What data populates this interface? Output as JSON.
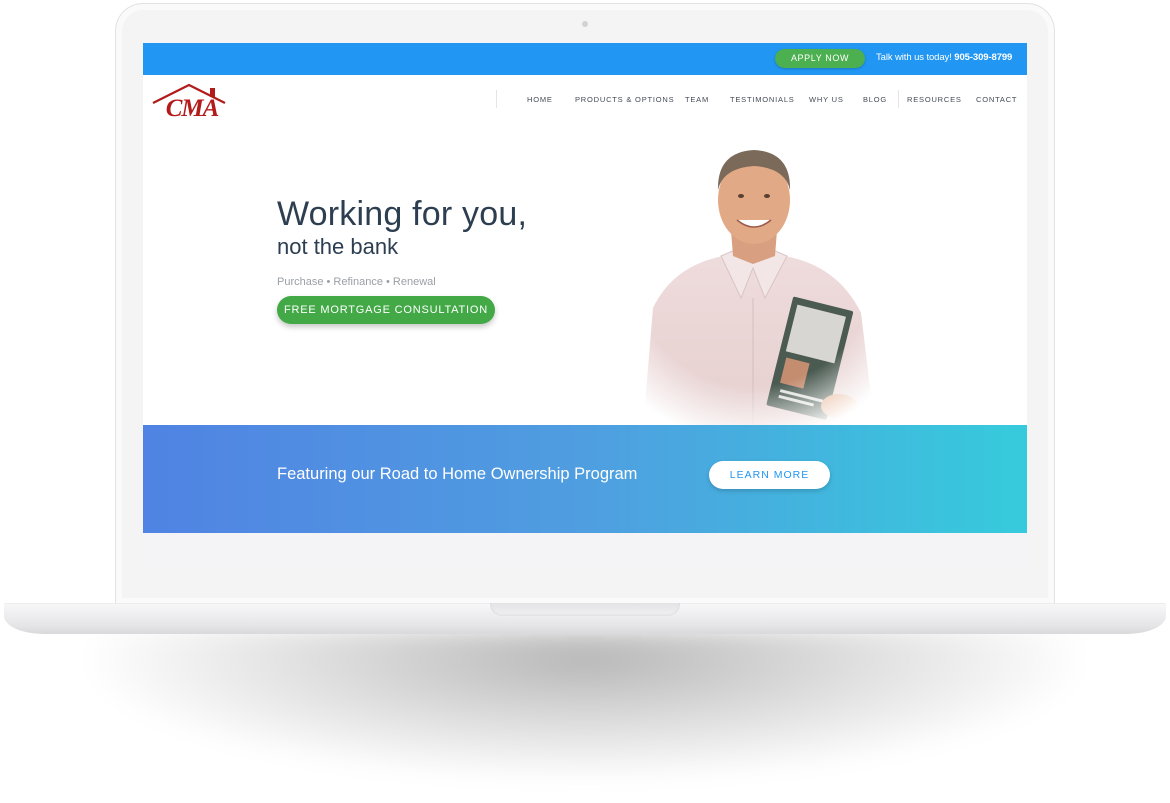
{
  "topbar": {
    "apply_label": "APPLY NOW",
    "talk_text": "Talk with us today!",
    "phone": "905-309-8799"
  },
  "logo": {
    "text": "CMA"
  },
  "nav": {
    "items": [
      "HOME",
      "PRODUCTS & OPTIONS",
      "TEAM",
      "TESTIMONIALS",
      "WHY US",
      "BLOG",
      "RESOURCES",
      "CONTACT"
    ]
  },
  "hero": {
    "headline": "Working for you,",
    "subheadline": "not the bank",
    "services": "Purchase • Refinance • Renewal",
    "cta_label": "FREE MORTGAGE CONSULTATION"
  },
  "banner": {
    "text": "Featuring our Road to Home Ownership Program",
    "cta_label": "LEARN MORE"
  },
  "colors": {
    "topbar": "#2196f3",
    "primary_green": "#43a947",
    "banner_start": "#5083e3",
    "banner_end": "#36cbdc",
    "logo_red": "#b31b1b",
    "heading": "#2c3e50"
  }
}
